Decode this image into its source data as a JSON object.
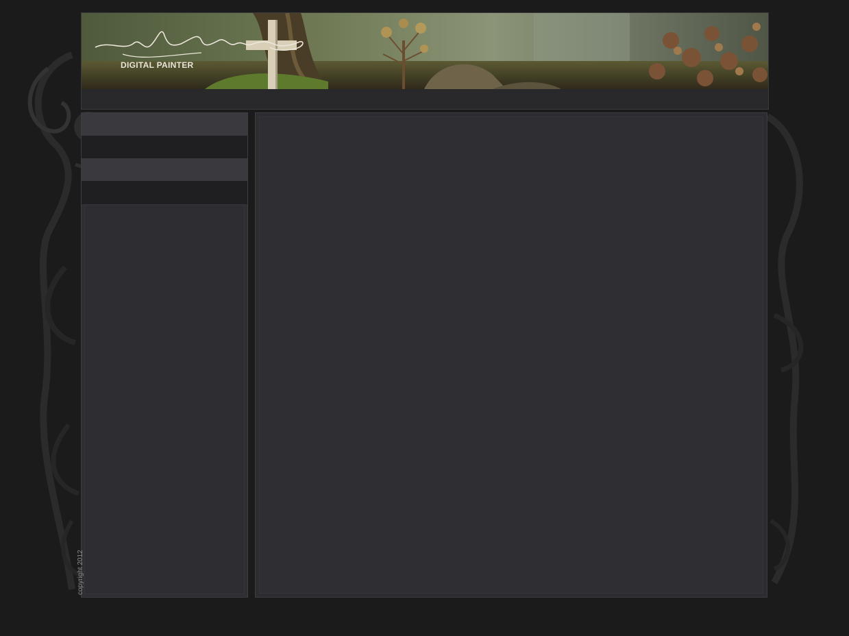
{
  "header": {
    "signature": "Carsten Woller",
    "subtitle": "DIGITAL PAINTER"
  },
  "footer": {
    "copyright": "copyright 2012"
  },
  "colors": {
    "page_bg": "#1b1b1b",
    "panel_bg": "#2e2e32",
    "strip_light": "#3a3a3e",
    "strip_dark": "#1f1f21"
  }
}
